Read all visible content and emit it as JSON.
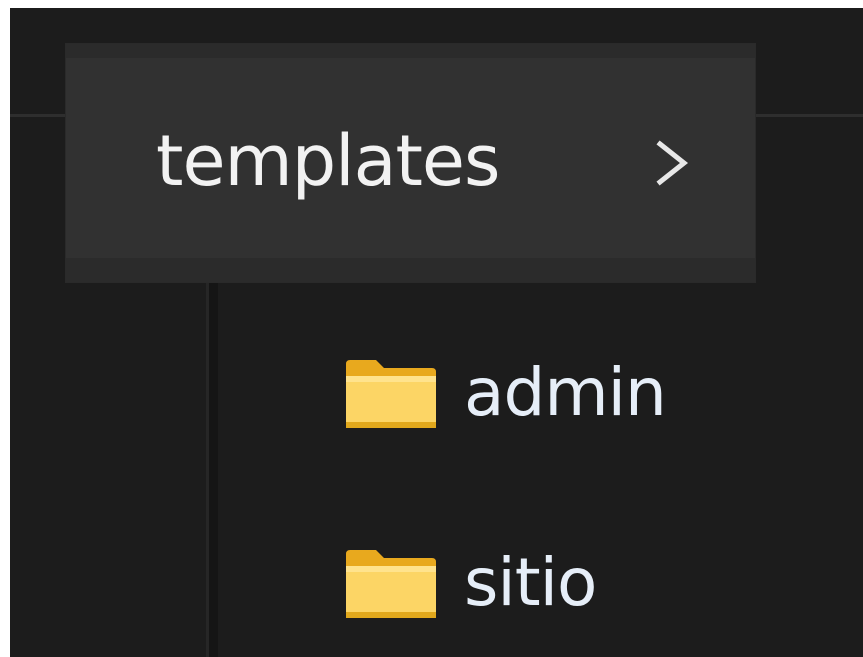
{
  "breadcrumb": {
    "label": "templates",
    "chevron_icon": "chevron-right-icon"
  },
  "folders": [
    {
      "label": "admin",
      "icon": "folder-icon"
    },
    {
      "label": "sitio",
      "icon": "folder-icon"
    }
  ],
  "colors": {
    "background": "#1c1c1c",
    "breadcrumb_bg": "#313131",
    "folder_yellow": "#f8c94a",
    "text": "#f2f2f2"
  }
}
